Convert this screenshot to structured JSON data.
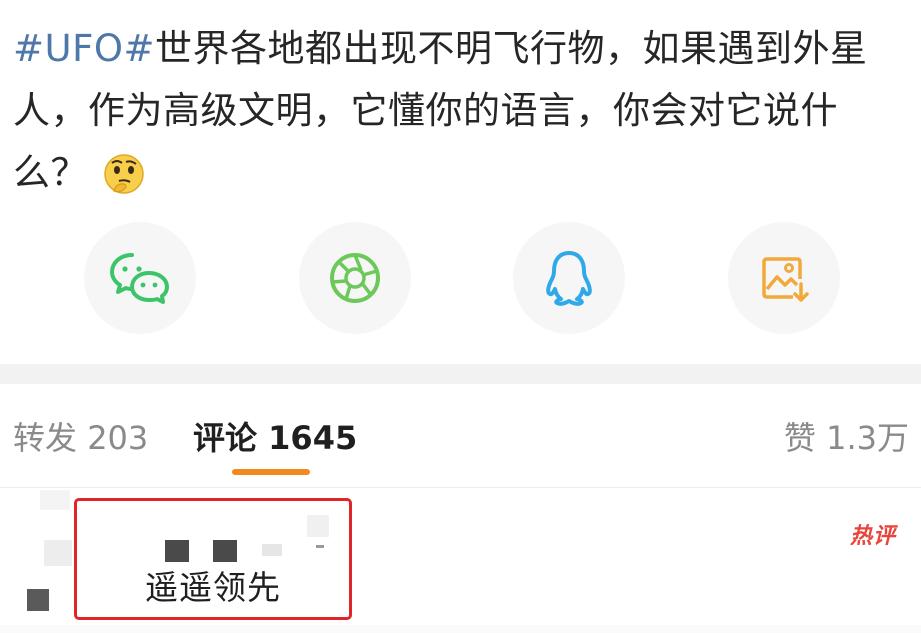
{
  "post": {
    "hashtag": "#UFO#",
    "text": "世界各地都出现不明飞行物，如果遇到外星人，作为高级文明，它懂你的语言，你会对它说什么？",
    "emoji": "thinking-face-icon"
  },
  "share": {
    "items": [
      {
        "name": "wechat",
        "icon": "wechat-icon",
        "color": "#3cc46a"
      },
      {
        "name": "moments",
        "icon": "moments-shutter-icon",
        "color": "#6dc85a"
      },
      {
        "name": "qq",
        "icon": "qq-penguin-icon",
        "color": "#2fa9e8"
      },
      {
        "name": "save-image",
        "icon": "save-image-icon",
        "color": "#f2a93b"
      }
    ]
  },
  "tabs": {
    "repost": {
      "label": "转发",
      "count": "203"
    },
    "comment": {
      "label": "评论",
      "count": "1645"
    },
    "like": {
      "label": "赞",
      "count": "1.3万"
    },
    "accent_color": "#f28a1f"
  },
  "comment": {
    "text": "遥遥领先",
    "badge": "热评",
    "highlight_color": "#e0252a"
  }
}
